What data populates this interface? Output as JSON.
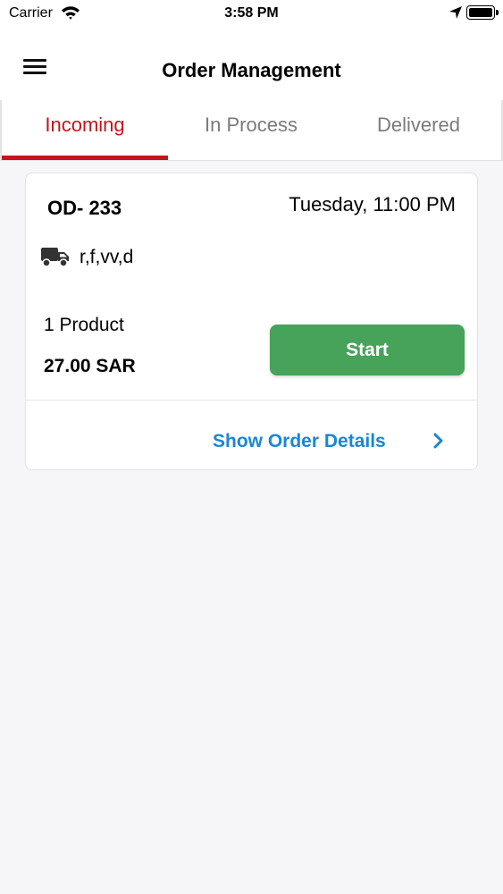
{
  "status_bar": {
    "carrier": "Carrier",
    "time": "3:58 PM",
    "icons": [
      "wifi-icon",
      "location-arrow-icon",
      "battery-icon"
    ]
  },
  "nav": {
    "title": "Order Management",
    "menu_icon": "hamburger-menu-icon"
  },
  "tabs": [
    {
      "label": "Incoming",
      "active": true
    },
    {
      "label": "In Process",
      "active": false
    },
    {
      "label": "Delivered",
      "active": false
    }
  ],
  "colors": {
    "accent": "#c0161c",
    "start_button": "#47a25a",
    "link": "#1a86d6",
    "background": "#f6f5f7"
  },
  "order": {
    "id": "OD- 233",
    "date": "Tuesday, 11:00 PM",
    "address": "r,f,vv,d",
    "address_icon": "truck-icon",
    "products": "1 Product",
    "price": "27.00 SAR",
    "start_label": "Start",
    "details_label": "Show Order Details",
    "details_icon": "chevron-right-icon"
  }
}
